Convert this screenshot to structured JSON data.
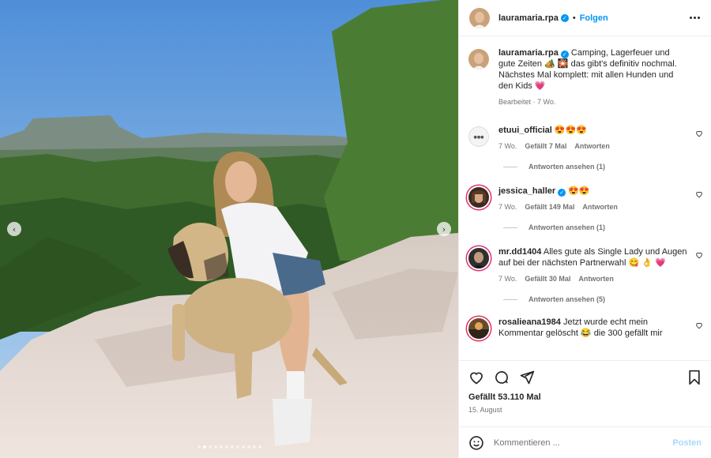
{
  "post": {
    "author": "lauramaria.rpa",
    "follow_label": "Folgen",
    "separator": "•",
    "caption_text": "Camping, Lagerfeuer und gute Zeiten 🏕️ 🎇 das gibt's definitiv nochmal. Nächstes Mal komplett: mit allen Hunden und den Kids 💗",
    "caption_edited": "Bearbeitet · 7 Wo.",
    "likes": "Gefällt 53.110 Mal",
    "date": "15. August",
    "carousel_position": "2/12"
  },
  "comments": [
    {
      "user": "etuui_official",
      "text": "😍😍😍",
      "time": "7 Wo.",
      "likes": "Gefällt 7 Mal",
      "reply": "Antworten",
      "view_replies": "Antworten ansehen (1)"
    },
    {
      "user": "jessica_haller",
      "text": "😍😍",
      "time": "7 Wo.",
      "likes": "Gefällt 149 Mal",
      "reply": "Antworten",
      "view_replies": "Antworten ansehen (1)"
    },
    {
      "user": "mr.dd1404",
      "text": "Alles gute als Single Lady und Augen auf bei der nächsten Partnerwahl 😋 👌 💗",
      "time": "7 Wo.",
      "likes": "Gefällt 30 Mal",
      "reply": "Antworten",
      "view_replies": "Antworten ansehen (5)"
    },
    {
      "user": "rosalieana1984",
      "text": "Jetzt wurde echt mein Kommentar gelöscht 😂 die 300 gefällt mir",
      "time": "",
      "likes": "",
      "reply": "",
      "view_replies": ""
    }
  ],
  "composer": {
    "placeholder": "Kommentieren ...",
    "post_label": "Posten"
  },
  "icons": {
    "like": "heart-icon",
    "comment": "comment-icon",
    "share": "send-icon",
    "save": "bookmark-icon",
    "emoji": "emoji-icon",
    "more": "more-options-icon"
  },
  "colors": {
    "accent": "#0095f6",
    "story_ring": "#e1306c",
    "muted": "#737373"
  }
}
